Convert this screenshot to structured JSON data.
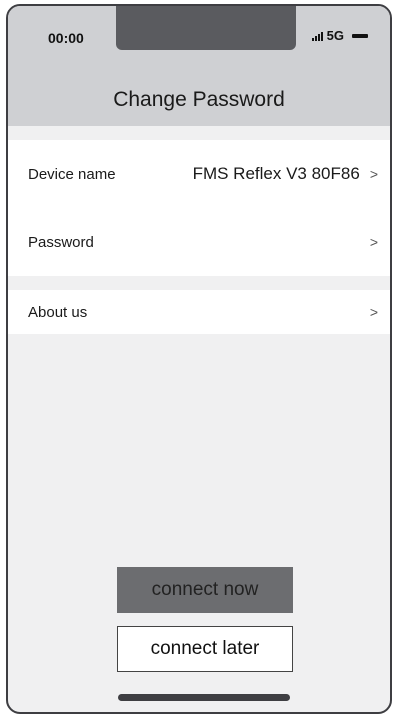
{
  "status_bar": {
    "time": "00:00",
    "network": "5G",
    "icons": [
      "signal-bars-icon",
      "battery-icon"
    ]
  },
  "header": {
    "title": "Change Password"
  },
  "settings": {
    "device_name_label": "Device name",
    "device_name_value": "FMS Reflex V3 80F86",
    "password_label": "Password",
    "about_label": "About us",
    "chevron": ">"
  },
  "actions": {
    "connect_now": "connect now",
    "connect_later": "connect later"
  },
  "colors": {
    "header_bg": "#cfd0d3",
    "screen_bg": "#f0f0f1",
    "primary_button": "#6c6d70",
    "frame": "#3e3e42"
  }
}
